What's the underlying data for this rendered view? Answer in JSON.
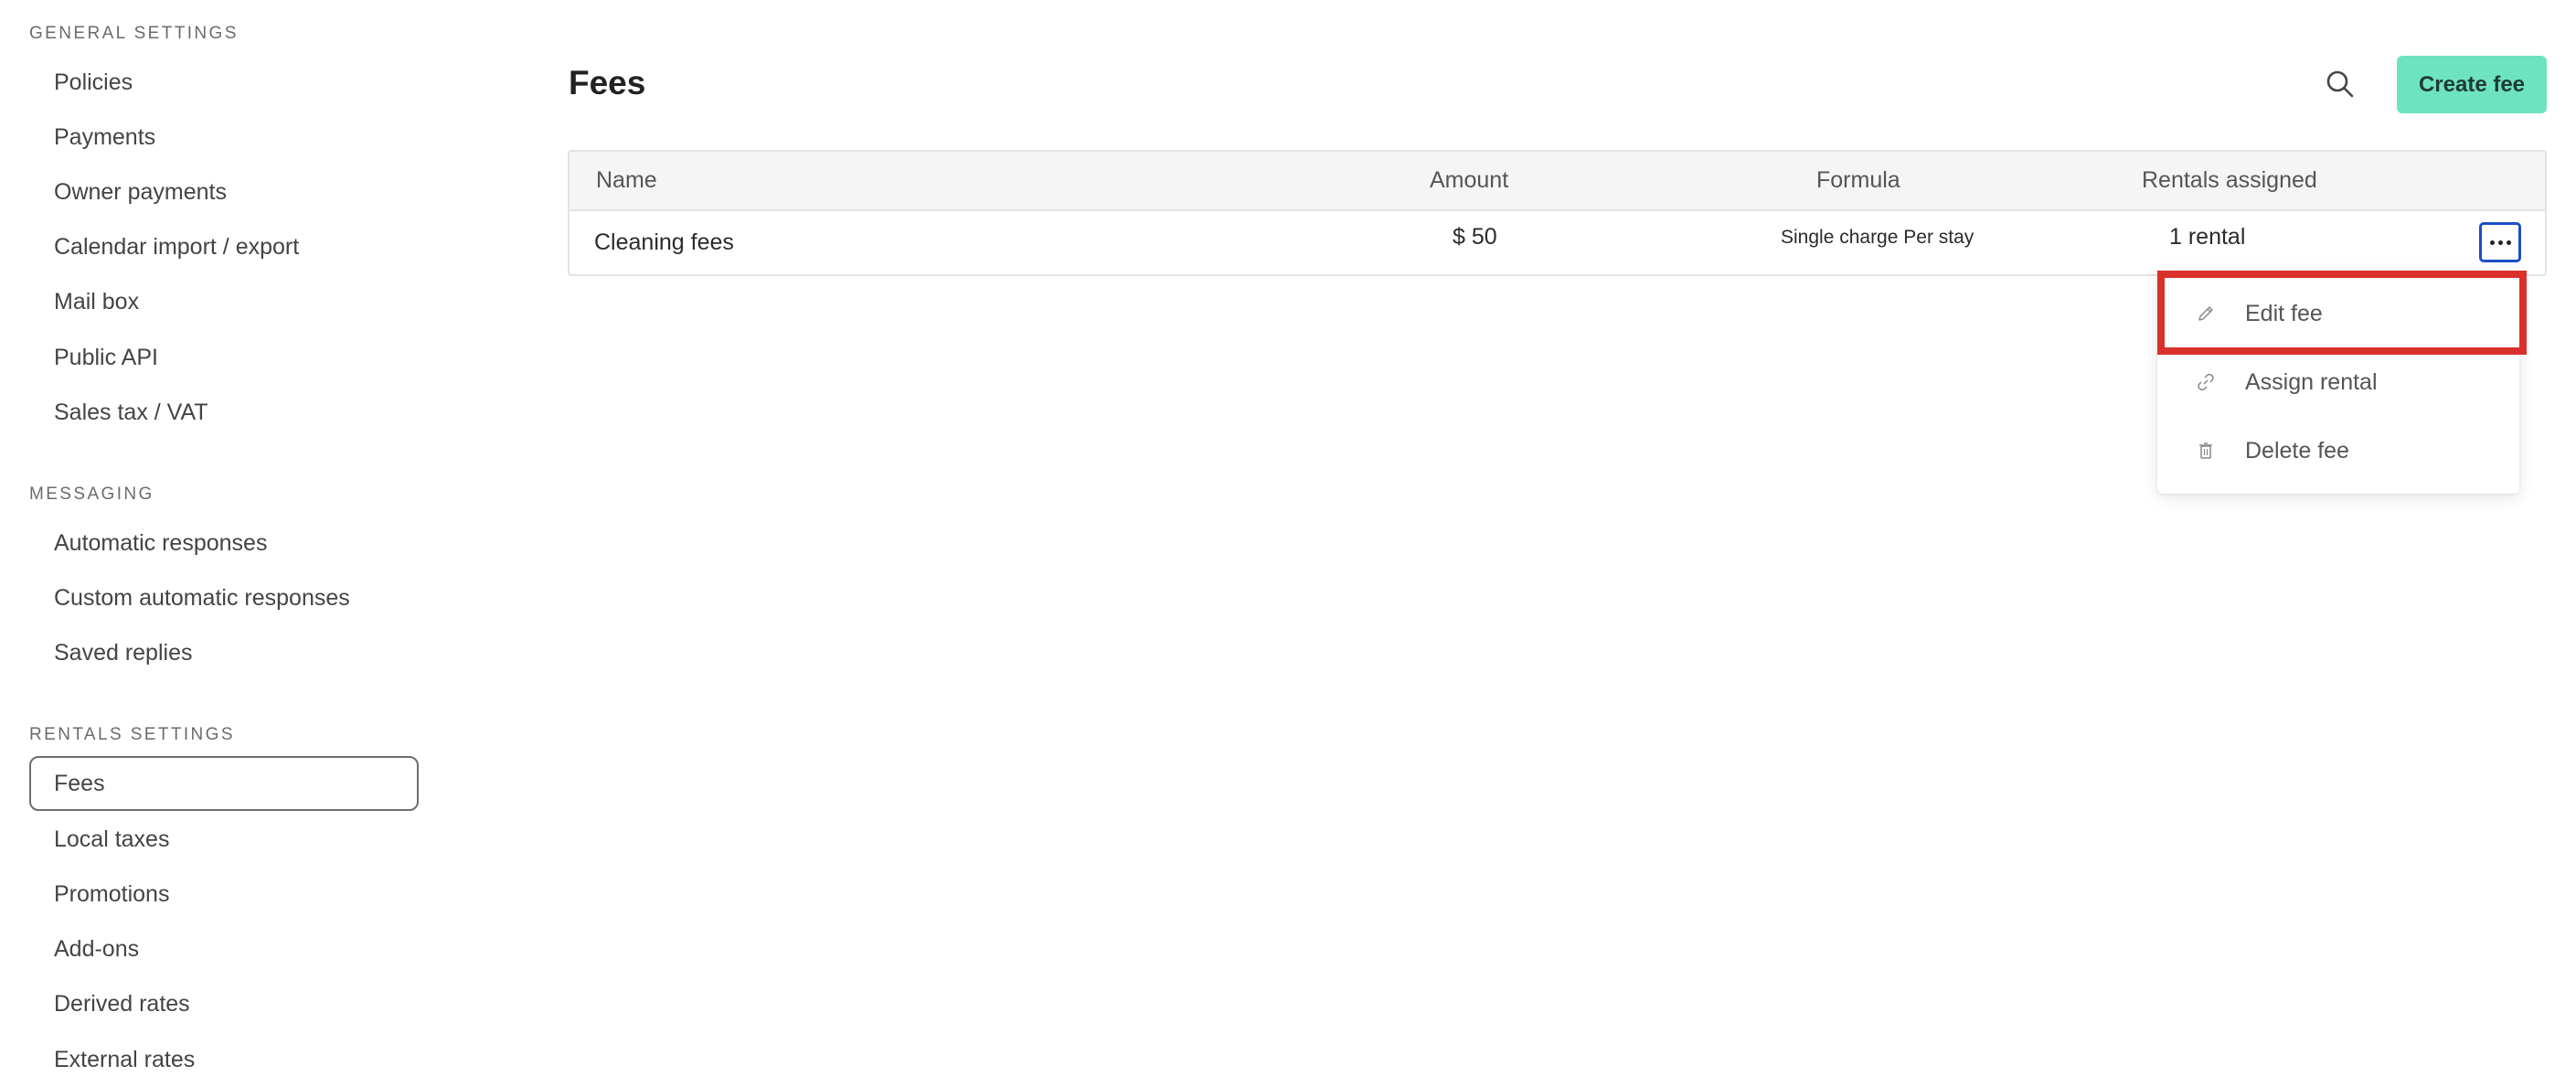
{
  "sidebar": {
    "general_title": "GENERAL SETTINGS",
    "general_items": [
      "Policies",
      "Payments",
      "Owner payments",
      "Calendar import / export",
      "Mail box",
      "Public API",
      "Sales tax / VAT"
    ],
    "messaging_title": "MESSAGING",
    "messaging_items": [
      "Automatic responses",
      "Custom automatic responses",
      "Saved replies"
    ],
    "rentals_title": "RENTALS SETTINGS",
    "rentals_items": [
      "Fees",
      "Local taxes",
      "Promotions",
      "Add-ons",
      "Derived rates",
      "External rates"
    ],
    "active_item": "Fees"
  },
  "header": {
    "title": "Fees",
    "create_label": "Create fee",
    "search_icon": "search-icon"
  },
  "table": {
    "columns": [
      "Name",
      "Amount",
      "Formula",
      "Rentals assigned"
    ],
    "rows": [
      {
        "name": "Cleaning fees",
        "amount": "$ 50",
        "formula": "Single charge Per stay",
        "rentals": "1 rental"
      }
    ]
  },
  "menu": {
    "items": [
      {
        "label": "Edit fee",
        "icon": "pencil-icon"
      },
      {
        "label": "Assign rental",
        "icon": "link-icon"
      },
      {
        "label": "Delete fee",
        "icon": "trash-icon"
      }
    ]
  },
  "colors": {
    "accent": "#6ee3c0",
    "focus_border": "#1c4fc4",
    "highlight": "#d9302b"
  }
}
